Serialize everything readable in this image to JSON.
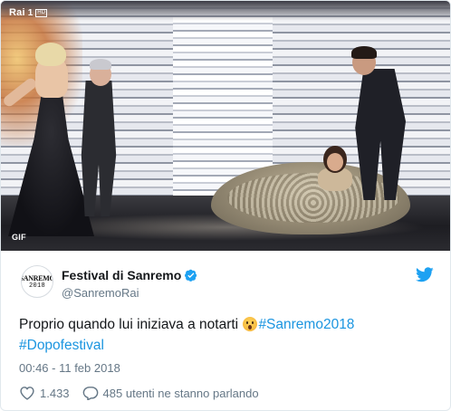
{
  "media": {
    "channel_logo": {
      "word": "Rai",
      "number": "1",
      "quality": "HD"
    },
    "badge": "GIF"
  },
  "account": {
    "display_name": "Festival di Sanremo",
    "handle": "@SanremoRai",
    "avatar": {
      "line1": "SANREMO",
      "line2": "2018"
    },
    "verified": true
  },
  "tweet": {
    "text_before_emoji": "Proprio quando lui iniziava a notarti ",
    "emoji": "hushed-face",
    "hashtags": [
      "#Sanremo2018",
      "#Dopofestival"
    ],
    "timestamp": "00:46 - 11 feb 2018"
  },
  "actions": {
    "likes_count": "1.433",
    "conversation_label": "485 utenti ne stanno parlando"
  },
  "colors": {
    "link": "#1b95e0",
    "secondary_text": "#657786",
    "primary_text": "#14171a",
    "verified_badge": "#1da1f2",
    "twitter_bird": "#1da1f2"
  }
}
